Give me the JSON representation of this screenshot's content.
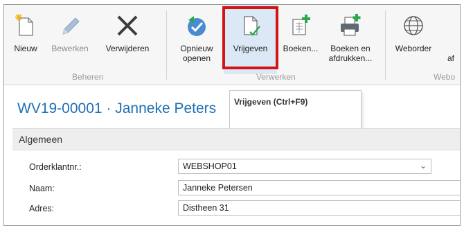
{
  "ribbon": {
    "buttons": {
      "nieuw": "Nieuw",
      "bewerken": "Bewerken",
      "verwijderen": "Verwijderen",
      "opnieuw_openen": "Opnieuw\nopenen",
      "vrijgeven": "Vrijgeven",
      "boeken": "Boeken...",
      "boeken_afdrukken": "Boeken en\nafdrukken...",
      "weborder": "Weborder",
      "weborder_truncated": "af"
    },
    "groups": {
      "beheren": "Beheren",
      "verwerken": "Verwerken",
      "webo": "Webo"
    },
    "icons": {
      "nieuw": "new-document-icon",
      "bewerken": "pencil-icon",
      "verwijderen": "x-delete-icon",
      "opnieuw_openen": "reopen-icon",
      "vrijgeven": "release-document-check-icon",
      "boeken": "post-document-icon",
      "boeken_afdrukken": "post-print-icon",
      "weborder": "globe-icon"
    },
    "highlight_color": "#d21414"
  },
  "page": {
    "title": "WV19-00001 · Janneke Peters"
  },
  "tooltip": {
    "text": "Vrijgeven (Ctrl+F9)"
  },
  "section": {
    "label": "Algemeen"
  },
  "form": {
    "orderklantnr_label": "Orderklantnr.:",
    "orderklantnr_value": "WEBSHOP01",
    "naam_label": "Naam:",
    "naam_value": "Janneke Petersen",
    "adres_label": "Adres:",
    "adres_value": "Distheen 31"
  },
  "colors": {
    "title_blue": "#1f6fb4",
    "accent_green": "#2aa84a"
  }
}
